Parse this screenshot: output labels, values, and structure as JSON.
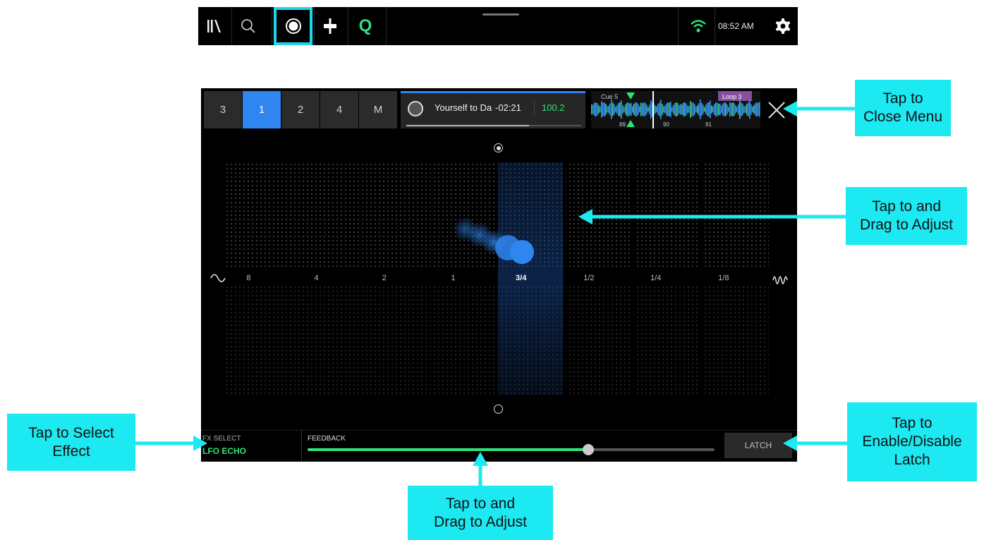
{
  "topbar": {
    "time": "08:52 AM",
    "icons": [
      "library-icon",
      "search-icon",
      "fx-icon",
      "split-icon",
      "quantize-icon",
      "wifi-icon",
      "gear-icon"
    ],
    "q_label": "Q"
  },
  "decks": {
    "tabs": [
      "3",
      "1",
      "2",
      "4",
      "M"
    ],
    "active": "1"
  },
  "track": {
    "title": "Yourself to Dance",
    "time_remaining": "-02:21",
    "bpm": "100.2",
    "progress": 0.7
  },
  "waveform": {
    "cue_label": "Cue 5",
    "loop_label": "Loop 3",
    "beat_labels": [
      "89",
      "90",
      "91"
    ]
  },
  "scale": {
    "labels": [
      "8",
      "4",
      "2",
      "1",
      "3/4",
      "1/2",
      "1/4",
      "1/8"
    ],
    "selected": "3/4"
  },
  "bottom": {
    "fx_select_label": "FX SELECT",
    "fx_select_value": "LFO ECHO",
    "feedback_label": "FEEDBACK",
    "feedback_value": 0.69,
    "latch_label": "LATCH"
  },
  "colors": {
    "accent_blue": "#2f86f0",
    "accent_green": "#2fe37a",
    "callout": "#1de9f2",
    "highlight_border": "#1fd6e8"
  },
  "callouts": {
    "close_menu": [
      "Tap to",
      "Close Menu"
    ],
    "drag_xy": [
      "Tap to and",
      "Drag to Adjust"
    ],
    "select_effect": [
      "Tap to Select",
      "Effect"
    ],
    "latch": [
      "Tap to",
      "Enable/Disable",
      "Latch"
    ],
    "drag_slider": [
      "Tap to and",
      "Drag to Adjust"
    ]
  }
}
